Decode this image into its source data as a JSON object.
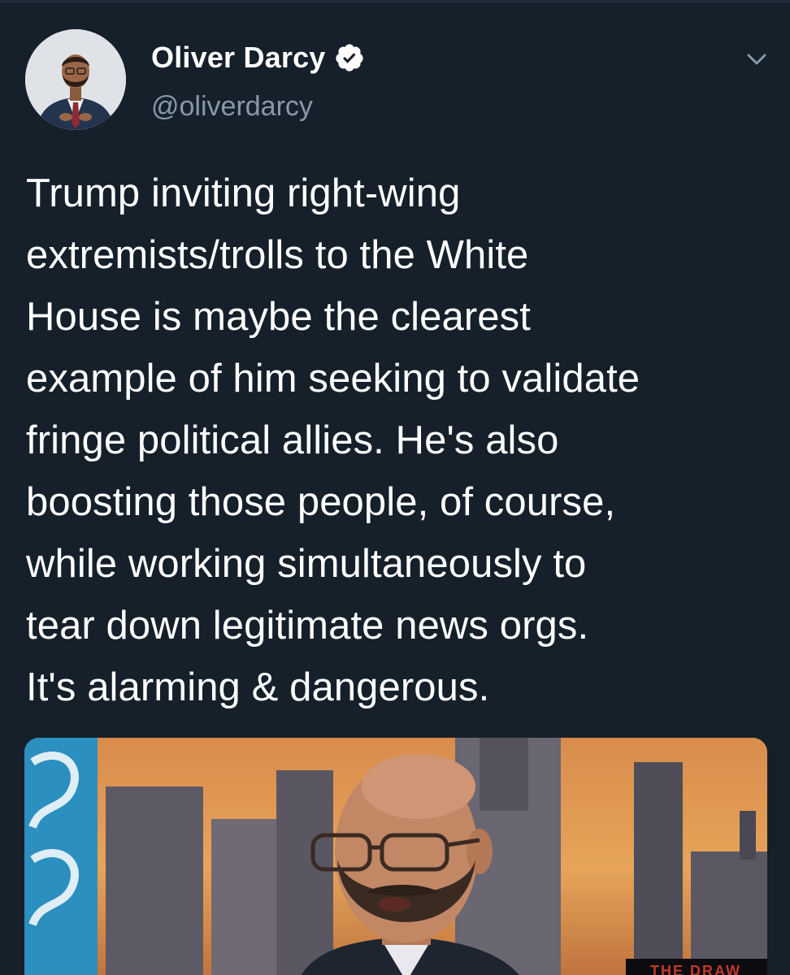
{
  "tweet": {
    "author": {
      "display_name": "Oliver Darcy",
      "handle": "@oliverdarcy",
      "verified": true
    },
    "text": "Trump inviting right-wing\nextremists/trolls to the White\nHouse is maybe the clearest\nexample of him seeking to validate\nfringe political allies. He's also\nboosting those people, of course,\nwhile working simultaneously to\ntear down legitimate news orgs.\nIt's alarming & dangerous.",
    "media": {
      "caption_fragment": "THE DRAW"
    }
  },
  "icons": {
    "verified": "verified-badge-icon",
    "menu": "chevron-down-icon"
  },
  "colors": {
    "background": "#15202b",
    "secondary_text": "#8899a6",
    "primary_text": "#ffffff"
  }
}
